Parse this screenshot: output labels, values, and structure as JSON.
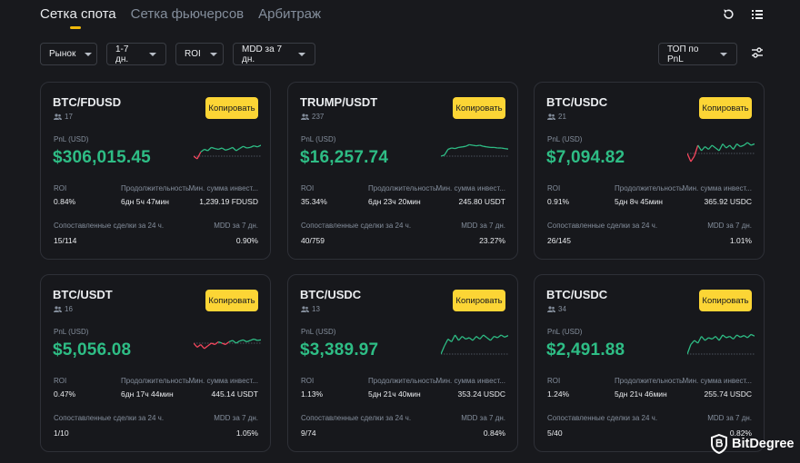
{
  "tabs": [
    "Сетка спота",
    "Сетка фьючерсов",
    "Арбитраж"
  ],
  "filters": [
    "Рынок",
    "1-7 дн.",
    "ROI",
    "MDD за 7 дн."
  ],
  "sort_label": "ТОП по PnL",
  "labels": {
    "copy": "Копировать",
    "pnl": "PnL (USD)",
    "roi": "ROI",
    "duration": "Продолжительность",
    "min_invest": "Мин. сумма инвест...",
    "matched": "Сопоставленные сделки за 24 ч.",
    "mdd": "MDD за 7 дн."
  },
  "cards": [
    {
      "pair": "BTC/FDUSD",
      "users": "17",
      "pnl": "$306,015.45",
      "roi": "0.84%",
      "duration": "6дн 5ч 47мин",
      "min_invest": "1,239.19 FDUSD",
      "matched": "15/114",
      "mdd": "0.90%",
      "trend": [
        0.3,
        0.2,
        0.45,
        0.55,
        0.5,
        0.62,
        0.58,
        0.55,
        0.6,
        0.52,
        0.56,
        0.62,
        0.5,
        0.58,
        0.66,
        0.6,
        0.62,
        0.68,
        0.64,
        0.7
      ]
    },
    {
      "pair": "TRUMP/USDT",
      "users": "237",
      "pnl": "$16,257.74",
      "roi": "35.34%",
      "duration": "6дн 23ч 20мин",
      "min_invest": "245.80 USDT",
      "matched": "40/759",
      "mdd": "23.27%",
      "trend": [
        0.3,
        0.34,
        0.55,
        0.6,
        0.58,
        0.62,
        0.64,
        0.66,
        0.72,
        0.7,
        0.68,
        0.7,
        0.66,
        0.64,
        0.62,
        0.62,
        0.6,
        0.6,
        0.58,
        0.56
      ]
    },
    {
      "pair": "BTC/USDC",
      "users": "21",
      "pnl": "$7,094.82",
      "roi": "0.91%",
      "duration": "5дн 8ч 45мин",
      "min_invest": "365.92 USDC",
      "matched": "26/145",
      "mdd": "1.01%",
      "trend": [
        0.4,
        0.1,
        0.3,
        0.7,
        0.5,
        0.65,
        0.55,
        0.7,
        0.6,
        0.5,
        0.75,
        0.6,
        0.7,
        0.55,
        0.75,
        0.65,
        0.7,
        0.8,
        0.7,
        0.75
      ]
    },
    {
      "pair": "BTC/USDT",
      "users": "16",
      "pnl": "$5,056.08",
      "roi": "0.47%",
      "duration": "6дн 17ч 44мин",
      "min_invest": "445.14 USDT",
      "matched": "1/10",
      "mdd": "1.05%",
      "trend": [
        0.5,
        0.35,
        0.45,
        0.3,
        0.4,
        0.5,
        0.45,
        0.55,
        0.5,
        0.45,
        0.55,
        0.6,
        0.5,
        0.58,
        0.62,
        0.55,
        0.6,
        0.65,
        0.6,
        0.62
      ]
    },
    {
      "pair": "BTC/USDC",
      "users": "13",
      "pnl": "$3,389.97",
      "roi": "1.13%",
      "duration": "5дн 21ч 40мин",
      "min_invest": "353.24 USDC",
      "matched": "9/74",
      "mdd": "0.84%",
      "trend": [
        0.1,
        0.4,
        0.65,
        0.55,
        0.8,
        0.6,
        0.75,
        0.65,
        0.7,
        0.6,
        0.75,
        0.65,
        0.8,
        0.7,
        0.6,
        0.75,
        0.7,
        0.8,
        0.72,
        0.78
      ]
    },
    {
      "pair": "BTC/USDC",
      "users": "34",
      "pnl": "$2,491.88",
      "roi": "1.24%",
      "duration": "5дн 21ч 46мин",
      "min_invest": "255.74 USDC",
      "matched": "5/40",
      "mdd": "0.82%",
      "trend": [
        0.1,
        0.45,
        0.6,
        0.5,
        0.75,
        0.6,
        0.7,
        0.65,
        0.75,
        0.6,
        0.8,
        0.7,
        0.75,
        0.65,
        0.8,
        0.72,
        0.78,
        0.7,
        0.82,
        0.76
      ]
    }
  ],
  "brand": "BitDegree",
  "colors": {
    "accent": "#fcd535",
    "positive": "#2ebd85",
    "negative": "#f6465d"
  }
}
